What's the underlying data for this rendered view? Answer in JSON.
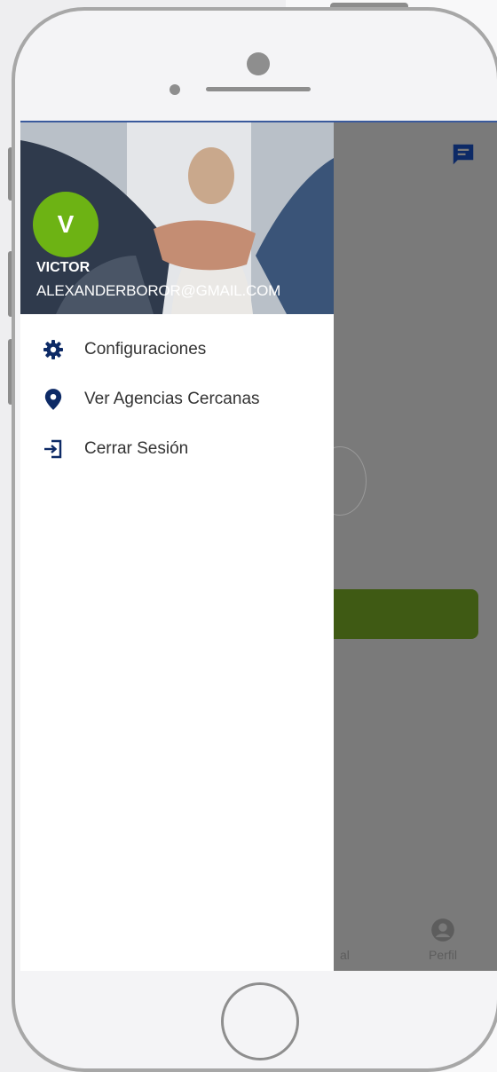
{
  "app": {
    "user": {
      "avatar_initial": "V",
      "name": "VICTOR",
      "email": "ALEXANDERBOROR@GMAIL.COM"
    },
    "menu": [
      {
        "label": "Configuraciones",
        "icon": "gear-icon"
      },
      {
        "label": "Ver Agencias Cercanas",
        "icon": "location-pin-icon"
      },
      {
        "label": "Cerrar Sesión",
        "icon": "logout-icon"
      }
    ],
    "background": {
      "nav_left_label": "al",
      "nav_profile_label": "Perfil"
    }
  },
  "colors": {
    "brand_navy": "#0d2a66",
    "avatar_green": "#6db314",
    "primary_green": "#3f5a14",
    "scrim": "#7a7a7a"
  }
}
